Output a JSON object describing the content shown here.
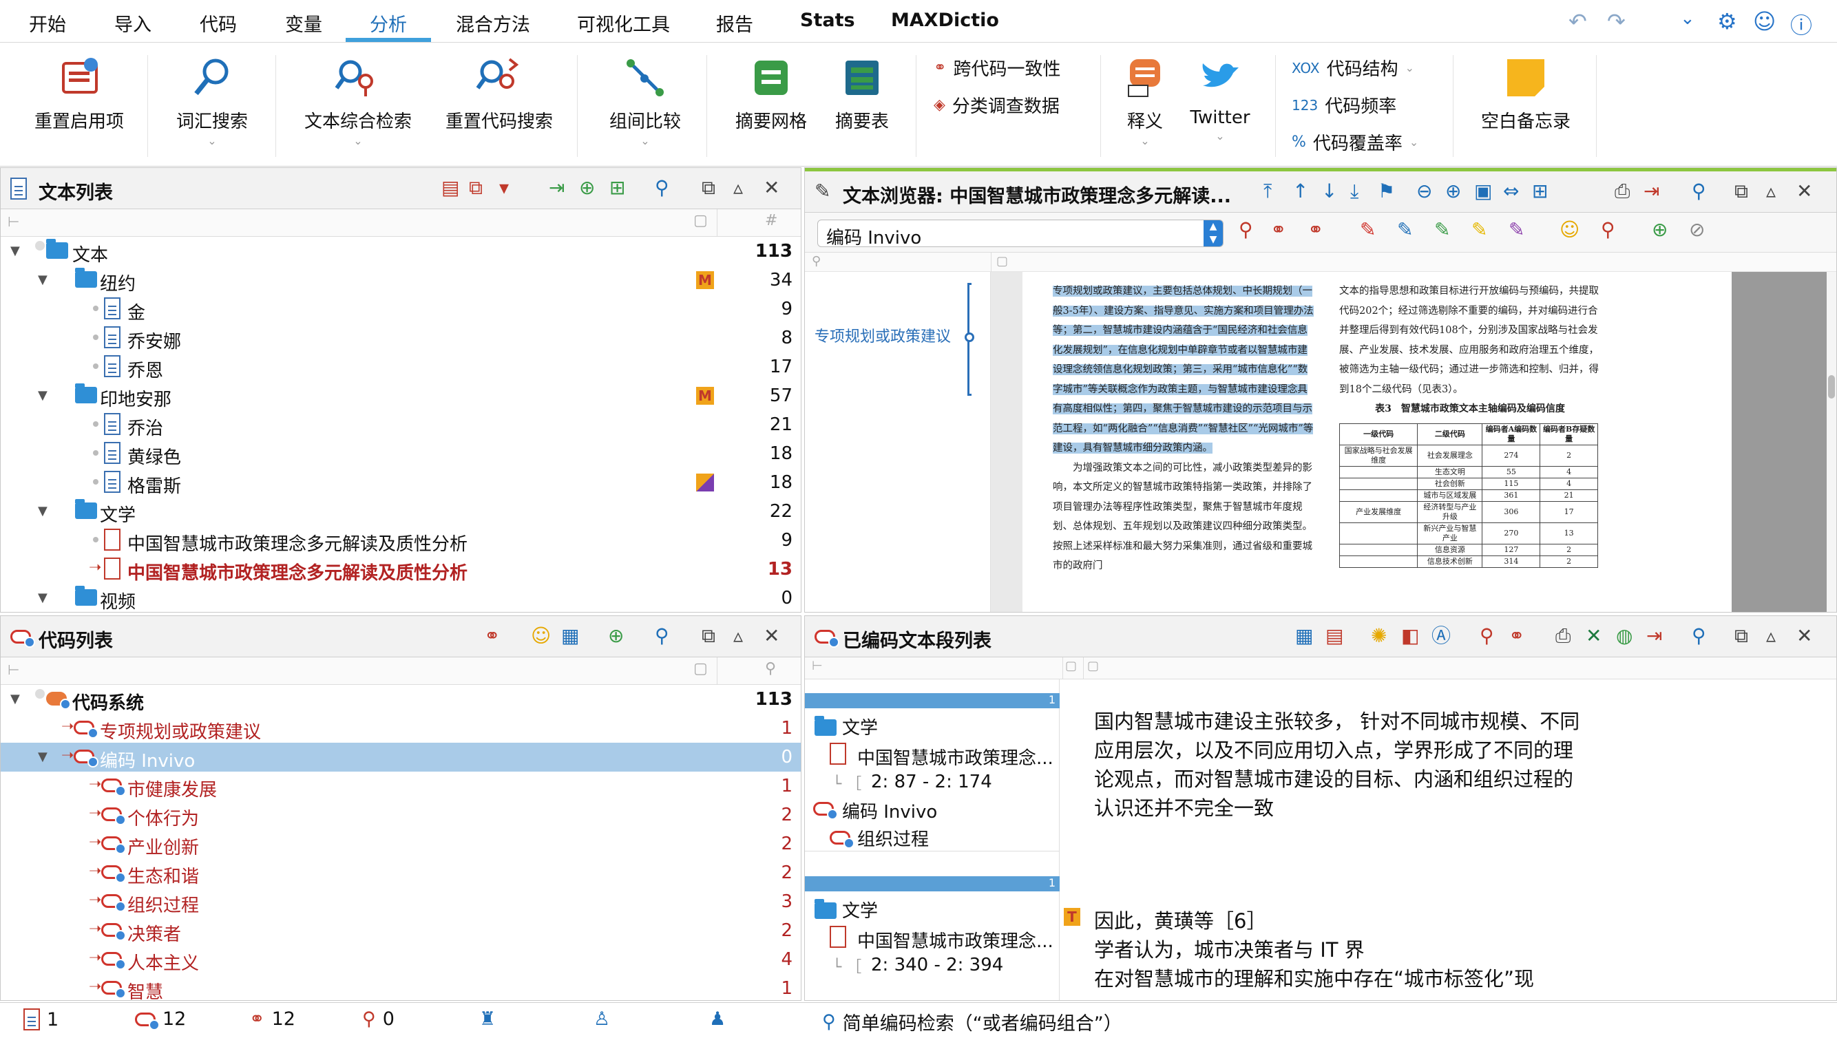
{
  "menu": {
    "items": [
      "开始",
      "导入",
      "代码",
      "变量",
      "分析",
      "混合方法",
      "可视化工具",
      "报告",
      "Stats",
      "MAXDictio"
    ],
    "active": "分析"
  },
  "ribbon": {
    "restart_label": "重置启用项",
    "word_search_label": "词汇搜索",
    "text_retrieval_label": "文本综合检索",
    "recode_search_label": "重置代码搜索",
    "group_compare_label": "组间比较",
    "summary_grid_label": "摘要网格",
    "summary_table_label": "摘要表",
    "cross_code_label": "跨代码一致性",
    "classify_survey_label": "分类调查数据",
    "paraphrase_label": "释义",
    "twitter_label": "Twitter",
    "code_structure_label": "代码结构",
    "code_frequency_label": "代码频率",
    "code_coverage_label": "代码覆盖率",
    "blank_memo_label": "空白备忘录",
    "xox_glyph": "XOX",
    "num_glyph": "123",
    "pct_glyph": "%"
  },
  "document_list": {
    "title": "文本列表",
    "count_header": "#",
    "rows": [
      {
        "label": "文本",
        "count": "113"
      },
      {
        "label": "纽约",
        "count": "34"
      },
      {
        "label": "金",
        "count": "9"
      },
      {
        "label": "乔安娜",
        "count": "8"
      },
      {
        "label": "乔恩",
        "count": "17"
      },
      {
        "label": "印地安那",
        "count": "57"
      },
      {
        "label": "乔治",
        "count": "21"
      },
      {
        "label": "黄绿色",
        "count": "18"
      },
      {
        "label": "格雷斯",
        "count": "18"
      },
      {
        "label": "文学",
        "count": "22"
      },
      {
        "label": "中国智慧城市政策理念多元解读及质性分析",
        "count": "9"
      },
      {
        "label": "中国智慧城市政策理念多元解读及质性分析",
        "count": "13"
      },
      {
        "label": "视频",
        "count": "0"
      }
    ],
    "memo_badge": "M"
  },
  "document_browser": {
    "title": "文本浏览器: 中国智慧城市政策理念多元解读...",
    "code_select": "编码 Invivo",
    "margin_code": "专项规划或政策建议",
    "doc_left_text": "专项规划或政策建议，主要包括总体规划、中长期规划（一般3-5年）、建设方案、指导意见、实施方案和项目管理办法等；第二，智慧城市建设内涵蕴含于“国民经济和社会信息化发展规划”，在信息化规划中单辟章节或者以智慧城市建设理念统领信息化规划政策；第三，采用“城市信息化”“数字城市”等关联概念作为政策主题，与智慧城市建设理念具有高度相似性；第四，聚焦于智慧城市建设的示范项目与示范工程，如“两化融合”“信息消费”“智慧社区”“光网城市”等建设，具有智慧城市细分政策内涵。",
    "doc_left_text2": "为增强政策文本之间的可比性，减小政策类型差异的影响，本文所定义的智慧城市政策特指第一类政策，并排除了项目管理办法等程序性政策类型，聚焦于智慧城市年度规划、总体规划、五年规划以及政策建议四种细分政策类型。按照上述采样标准和最大努力采集准则，通过省级和重要城市的政府门",
    "doc_right_text": "文本的指导思想和政策目标进行开放编码与预编码，共提取代码202个；经过筛选剔除不重要的编码，并对编码进行合并整理后得到有效代码108个，分别涉及国家战略与社会发展、产业发展、技术发展、应用服务和政府治理五个维度，被筛选为主轴一级代码；通过进一步筛选和控制、归并，得到18个二级代码（见表3）。",
    "table_title": "表3　智慧城市政策文本主轴编码及编码信度",
    "table_headers": [
      "一级代码",
      "二级代码",
      "编码者A编码数量",
      "编码者B存疑数量"
    ],
    "table_rows": [
      [
        "国家战略与社会发展维度",
        "社会发展理念",
        "274",
        "2"
      ],
      [
        "",
        "生态文明",
        "55",
        "4"
      ],
      [
        "",
        "社会创新",
        "115",
        "4"
      ],
      [
        "",
        "城市与区域发展",
        "361",
        "21"
      ],
      [
        "产业发展维度",
        "经济转型与产业升级",
        "306",
        "17"
      ],
      [
        "",
        "新兴产业与智慧产业",
        "270",
        "13"
      ],
      [
        "",
        "信息资源",
        "127",
        "2"
      ],
      [
        "",
        "信息技术创新",
        "314",
        "2"
      ]
    ]
  },
  "code_system": {
    "title": "代码列表",
    "rows": [
      {
        "label": "代码系统",
        "count": "113"
      },
      {
        "label": "专项规划或政策建议",
        "count": "1"
      },
      {
        "label": "编码 Invivo",
        "count": "0"
      },
      {
        "label": "市健康发展",
        "count": "1"
      },
      {
        "label": "个体行为",
        "count": "2"
      },
      {
        "label": "产业创新",
        "count": "2"
      },
      {
        "label": "生态和谐",
        "count": "2"
      },
      {
        "label": "组织过程",
        "count": "3"
      },
      {
        "label": "决策者",
        "count": "2"
      },
      {
        "label": "人本主义",
        "count": "4"
      },
      {
        "label": "智慧",
        "count": "1"
      }
    ]
  },
  "retrieved_segments": {
    "title": "已编码文本段列表",
    "segments": [
      {
        "num": "1",
        "doc_group": "文学",
        "doc_name": "中国智慧城市政策理念...",
        "position": "2: 87 - 2: 174",
        "code_parent": "编码 Invivo",
        "code": "组织过程",
        "text": "国内智慧城市建设主张较多，  针对不同城市规模、不同应用层次，以及不同应用切入点，学界形成了不同的理论观点，而对智慧城市建设的目标、内涵和组织过程的认识还并不完全一致"
      },
      {
        "num": "1",
        "doc_group": "文学",
        "doc_name": "中国智慧城市政策理念...",
        "position": "2: 340 - 2: 394",
        "text_line1": "因此，黄璜等［6］",
        "text_line2": "学者认为，城市决策者与 IT 界",
        "text_line3": "在对智慧城市的理解和实施中存在“城市标签化”现",
        "badge": "T"
      }
    ]
  },
  "status_bar": {
    "docs": "1",
    "codes": "12",
    "code_sets": "12",
    "vars": "0",
    "search_text": "简单编码检索（“或者编码组合”）"
  },
  "colors": {
    "accent_blue": "#3fa0dc",
    "selection_blue": "#a9cbe8",
    "code_red": "#c0392b",
    "folder_blue": "#2f8fd6",
    "memo_orange": "#f0a31a"
  }
}
